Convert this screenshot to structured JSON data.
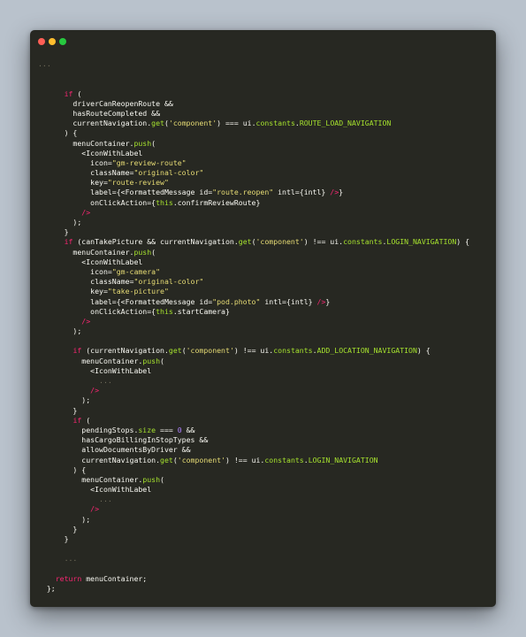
{
  "window": {
    "controls": [
      "close",
      "minimize",
      "maximize"
    ]
  },
  "colors": {
    "background": "#b9c2cc",
    "window": "#272822",
    "text": "#f8f8f2",
    "keyword": "#f92672",
    "string": "#e6db74",
    "function": "#a6e22e",
    "number": "#ae81ff",
    "comment": "#75715e",
    "close": "#ff5f56",
    "minimize": "#ffbd2e",
    "maximize": "#27c93f"
  },
  "code": {
    "lines": [
      [
        [
          "comment",
          "..."
        ]
      ],
      [],
      [],
      [
        [
          "text",
          "      "
        ],
        [
          "keyword",
          "if"
        ],
        [
          "text",
          " ("
        ]
      ],
      [
        [
          "text",
          "        driverCanReopenRoute &&"
        ]
      ],
      [
        [
          "text",
          "        hasRouteCompleted &&"
        ]
      ],
      [
        [
          "text",
          "        currentNavigation."
        ],
        [
          "func",
          "get"
        ],
        [
          "text",
          "("
        ],
        [
          "string",
          "'component'"
        ],
        [
          "text",
          ") === ui."
        ],
        [
          "func",
          "constants"
        ],
        [
          "text",
          "."
        ],
        [
          "func",
          "ROUTE_LOAD_NAVIGATION"
        ]
      ],
      [
        [
          "text",
          "      ) {"
        ]
      ],
      [
        [
          "text",
          "        menuContainer."
        ],
        [
          "func",
          "push"
        ],
        [
          "text",
          "("
        ]
      ],
      [
        [
          "text",
          "          <IconWithLabel"
        ]
      ],
      [
        [
          "text",
          "            icon="
        ],
        [
          "string",
          "\"gm-review-route\""
        ]
      ],
      [
        [
          "text",
          "            className="
        ],
        [
          "string",
          "\"original-color\""
        ]
      ],
      [
        [
          "text",
          "            key="
        ],
        [
          "string",
          "\"route-review\""
        ]
      ],
      [
        [
          "text",
          "            label={<FormattedMessage id="
        ],
        [
          "string",
          "\"route.reopen\""
        ],
        [
          "text",
          " intl={intl} "
        ],
        [
          "keyword",
          "/>"
        ],
        [
          "text",
          "}"
        ]
      ],
      [
        [
          "text",
          "            onClickAction={"
        ],
        [
          "func",
          "this"
        ],
        [
          "text",
          ".confirmReviewRoute}"
        ]
      ],
      [
        [
          "text",
          "          "
        ],
        [
          "keyword",
          "/>"
        ]
      ],
      [
        [
          "text",
          "        );"
        ]
      ],
      [
        [
          "text",
          "      }"
        ]
      ],
      [
        [
          "text",
          "      "
        ],
        [
          "keyword",
          "if"
        ],
        [
          "text",
          " (canTakePicture && currentNavigation."
        ],
        [
          "func",
          "get"
        ],
        [
          "text",
          "("
        ],
        [
          "string",
          "'component'"
        ],
        [
          "text",
          ") !== ui."
        ],
        [
          "func",
          "constants"
        ],
        [
          "text",
          "."
        ],
        [
          "func",
          "LOGIN_NAVIGATION"
        ],
        [
          "text",
          ") {"
        ]
      ],
      [
        [
          "text",
          "        menuContainer."
        ],
        [
          "func",
          "push"
        ],
        [
          "text",
          "("
        ]
      ],
      [
        [
          "text",
          "          <IconWithLabel"
        ]
      ],
      [
        [
          "text",
          "            icon="
        ],
        [
          "string",
          "\"gm-camera\""
        ]
      ],
      [
        [
          "text",
          "            className="
        ],
        [
          "string",
          "\"original-color\""
        ]
      ],
      [
        [
          "text",
          "            key="
        ],
        [
          "string",
          "\"take-picture\""
        ]
      ],
      [
        [
          "text",
          "            label={<FormattedMessage id="
        ],
        [
          "string",
          "\"pod.photo\""
        ],
        [
          "text",
          " intl={intl} "
        ],
        [
          "keyword",
          "/>"
        ],
        [
          "text",
          "}"
        ]
      ],
      [
        [
          "text",
          "            onClickAction={"
        ],
        [
          "func",
          "this"
        ],
        [
          "text",
          ".startCamera}"
        ]
      ],
      [
        [
          "text",
          "          "
        ],
        [
          "keyword",
          "/>"
        ]
      ],
      [
        [
          "text",
          "        );"
        ]
      ],
      [],
      [
        [
          "text",
          "        "
        ],
        [
          "keyword",
          "if"
        ],
        [
          "text",
          " (currentNavigation."
        ],
        [
          "func",
          "get"
        ],
        [
          "text",
          "("
        ],
        [
          "string",
          "'component'"
        ],
        [
          "text",
          ") !== ui."
        ],
        [
          "func",
          "constants"
        ],
        [
          "text",
          "."
        ],
        [
          "func",
          "ADD_LOCATION_NAVIGATION"
        ],
        [
          "text",
          ") {"
        ]
      ],
      [
        [
          "text",
          "          menuContainer."
        ],
        [
          "func",
          "push"
        ],
        [
          "text",
          "("
        ]
      ],
      [
        [
          "text",
          "            <IconWithLabel"
        ]
      ],
      [
        [
          "comment",
          "              ..."
        ]
      ],
      [
        [
          "text",
          "            "
        ],
        [
          "keyword",
          "/>"
        ]
      ],
      [
        [
          "text",
          "          );"
        ]
      ],
      [
        [
          "text",
          "        }"
        ]
      ],
      [
        [
          "text",
          "        "
        ],
        [
          "keyword",
          "if"
        ],
        [
          "text",
          " ("
        ]
      ],
      [
        [
          "text",
          "          pendingStops."
        ],
        [
          "func",
          "size"
        ],
        [
          "text",
          " === "
        ],
        [
          "number",
          "0"
        ],
        [
          "text",
          " &&"
        ]
      ],
      [
        [
          "text",
          "          hasCargoBillingInStopTypes &&"
        ]
      ],
      [
        [
          "text",
          "          allowDocumentsByDriver &&"
        ]
      ],
      [
        [
          "text",
          "          currentNavigation."
        ],
        [
          "func",
          "get"
        ],
        [
          "text",
          "("
        ],
        [
          "string",
          "'component'"
        ],
        [
          "text",
          ") !== ui."
        ],
        [
          "func",
          "constants"
        ],
        [
          "text",
          "."
        ],
        [
          "func",
          "LOGIN_NAVIGATION"
        ]
      ],
      [
        [
          "text",
          "        ) {"
        ]
      ],
      [
        [
          "text",
          "          menuContainer."
        ],
        [
          "func",
          "push"
        ],
        [
          "text",
          "("
        ]
      ],
      [
        [
          "text",
          "            <IconWithLabel"
        ]
      ],
      [
        [
          "comment",
          "              ..."
        ]
      ],
      [
        [
          "text",
          "            "
        ],
        [
          "keyword",
          "/>"
        ]
      ],
      [
        [
          "text",
          "          );"
        ]
      ],
      [
        [
          "text",
          "        }"
        ]
      ],
      [
        [
          "text",
          "      }"
        ]
      ],
      [],
      [
        [
          "comment",
          "      ..."
        ]
      ],
      [],
      [
        [
          "text",
          "    "
        ],
        [
          "keyword",
          "return"
        ],
        [
          "text",
          " menuContainer;"
        ]
      ],
      [
        [
          "text",
          "  };"
        ]
      ]
    ]
  }
}
